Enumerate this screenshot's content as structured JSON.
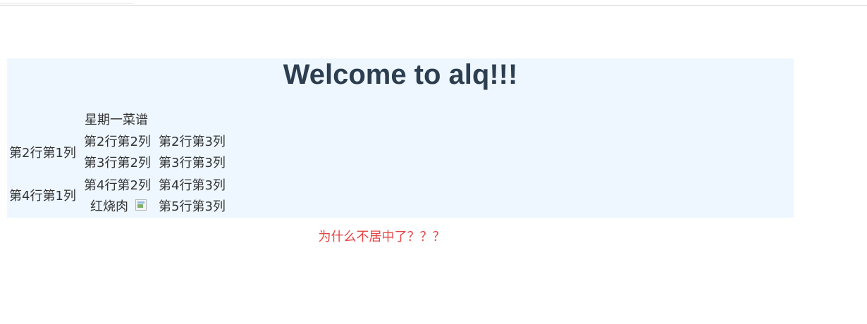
{
  "page": {
    "title": "Welcome to alq!!!",
    "note": "为什么不居中了？？？"
  },
  "table": {
    "caption": "星期一菜谱",
    "rows": [
      [
        "第2行第1列",
        "第2行第2列",
        "第2行第3列"
      ],
      [
        "",
        "第3行第2列",
        "第3行第3列"
      ],
      [
        "第4行第1列",
        "第4行第2列",
        "第4行第3列"
      ],
      [
        "红烧肉",
        "",
        "第5行第3列"
      ]
    ],
    "image_icon": "broken-image-icon"
  },
  "colors": {
    "panel_background": "#eef7ff",
    "title": "#2c3e50",
    "note": "#e64545"
  }
}
